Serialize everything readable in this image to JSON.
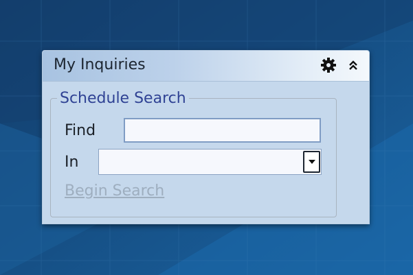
{
  "widget": {
    "title": "My Inquiries",
    "settings_icon": "gear-icon",
    "collapse_icon": "chevron-double-up-icon"
  },
  "schedule_search": {
    "legend": "Schedule Search",
    "find_label": "Find",
    "find_value": "",
    "in_label": "In",
    "in_value": "",
    "begin_search_label": "Begin Search",
    "begin_search_enabled": false
  },
  "colors": {
    "background": "#17578f",
    "panel": "#c5d8ec",
    "legend_text": "#2f4294",
    "disabled_link": "#9eaebf"
  }
}
